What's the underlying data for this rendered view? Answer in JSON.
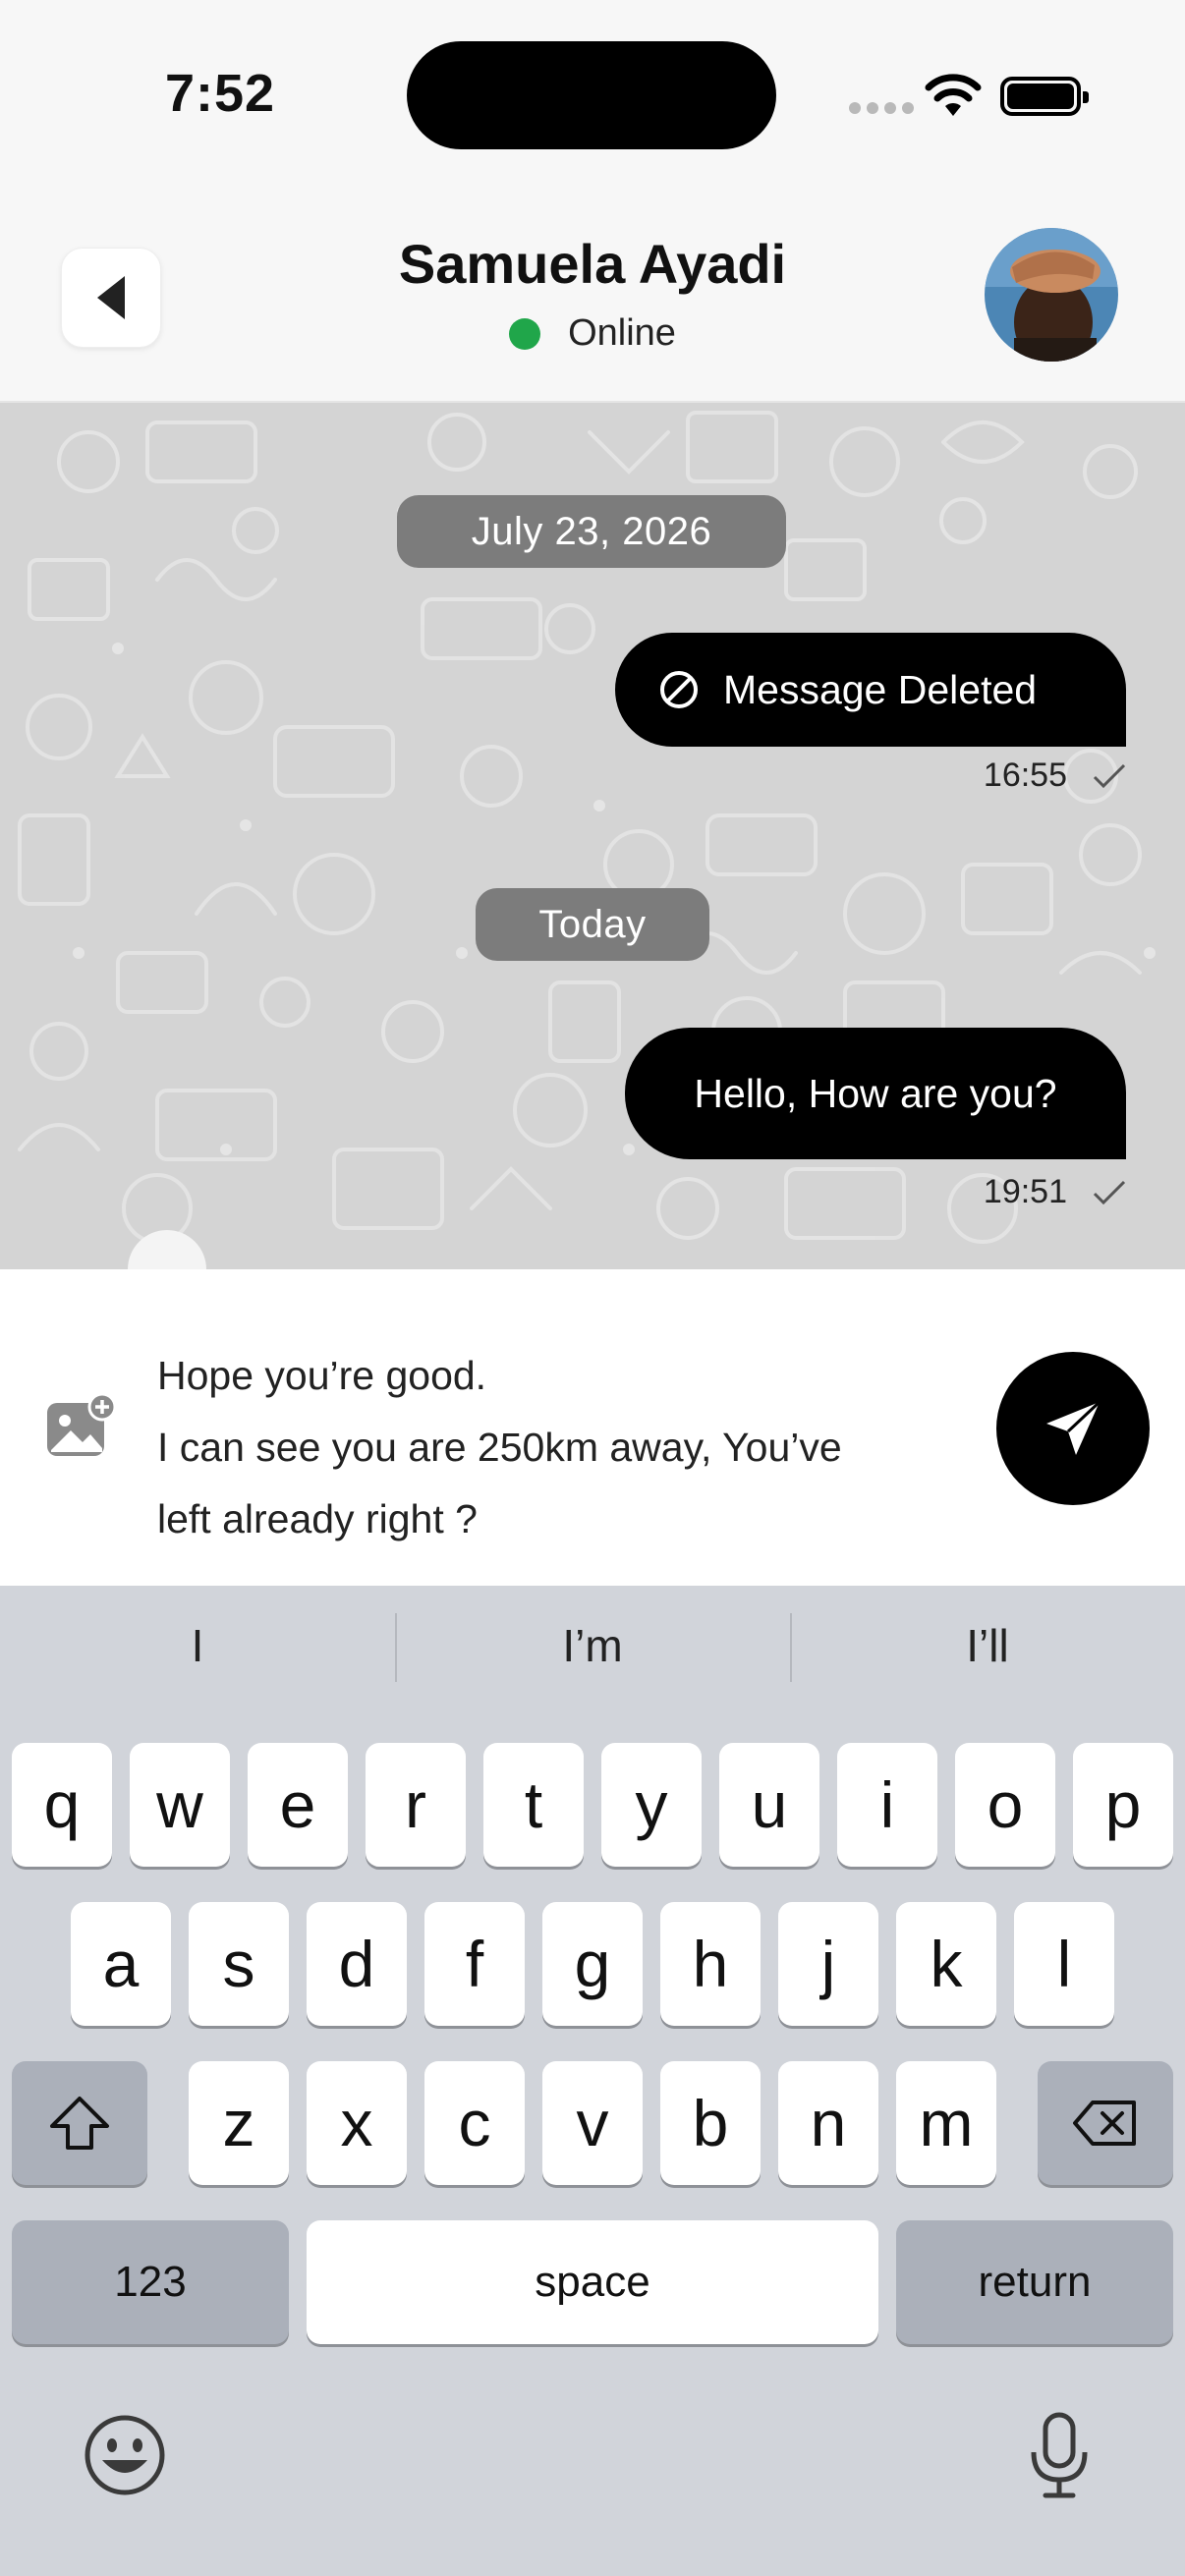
{
  "status_bar": {
    "time": "7:52"
  },
  "header": {
    "contact_name": "Samuela Ayadi",
    "presence": "Online",
    "presence_color": "#20a64a"
  },
  "chat": {
    "background_color": "#d4d4d4",
    "date_chips": [
      "July 23, 2026",
      "Today"
    ],
    "messages": [
      {
        "text": "Message Deleted",
        "time": "16:55",
        "icon": "prohibited-icon",
        "status": "sent-check"
      },
      {
        "text": "Hello, How are you?",
        "time": "19:51",
        "status": "sent-check"
      }
    ]
  },
  "composer": {
    "text": "Hope you’re good.\nI can see you are 250km away, You’ve\nleft already right ?",
    "attach_icon": "add-photo-icon",
    "send_icon": "paper-plane-icon"
  },
  "keyboard": {
    "suggestions": [
      "I",
      "I’m",
      "I’ll"
    ],
    "row1": [
      "q",
      "w",
      "e",
      "r",
      "t",
      "y",
      "u",
      "i",
      "o",
      "p"
    ],
    "row2": [
      "a",
      "s",
      "d",
      "f",
      "g",
      "h",
      "j",
      "k",
      "l"
    ],
    "row3": [
      "z",
      "x",
      "c",
      "v",
      "b",
      "n",
      "m"
    ],
    "numbers_label": "123",
    "space_label": "space",
    "return_label": "return"
  }
}
